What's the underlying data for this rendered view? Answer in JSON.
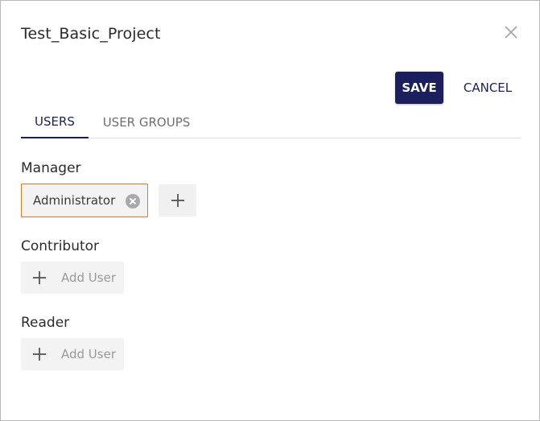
{
  "dialog": {
    "title": "Test_Basic_Project",
    "save_label": "SAVE",
    "cancel_label": "CANCEL"
  },
  "tabs": [
    {
      "label": "USERS",
      "active": true
    },
    {
      "label": "USER GROUPS",
      "active": false
    }
  ],
  "roles": {
    "manager": {
      "label": "Manager",
      "users": [
        "Administrator"
      ]
    },
    "contributor": {
      "label": "Contributor",
      "add_label": "Add User"
    },
    "reader": {
      "label": "Reader",
      "add_label": "Add User"
    }
  },
  "icons": {
    "close": "close-icon",
    "remove": "remove-circle-icon",
    "add": "plus-icon"
  },
  "colors": {
    "primary": "#1b1f5e",
    "chip_border": "#e07b1f"
  }
}
